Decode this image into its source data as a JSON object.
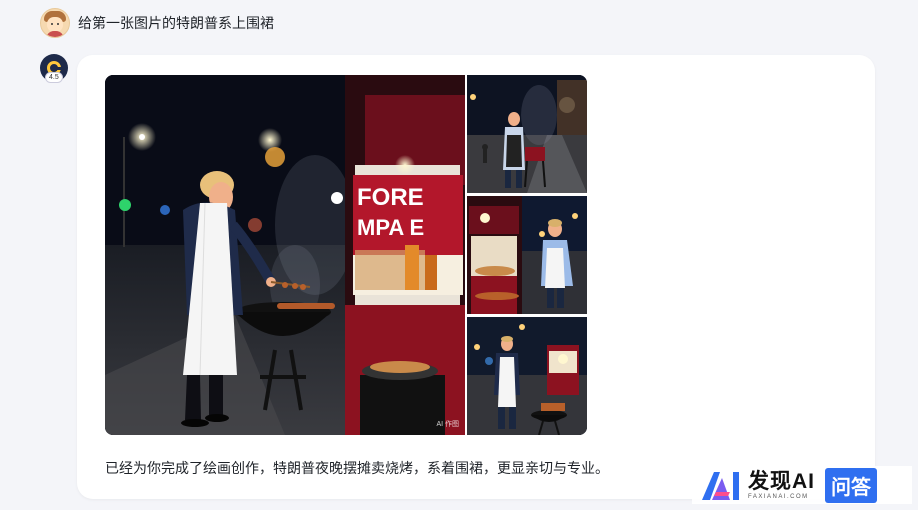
{
  "user_message": {
    "text": "给第一张图片的特朗普系上围裙"
  },
  "assistant": {
    "badge": "4.5",
    "reply": "已经为你完成了绘画创作，特朗普夜晚摆摊卖烧烤，系着围裙，更显亲切与专业。",
    "ai_mark": "AI 作图",
    "stall_sign": [
      "FORE",
      "MPA E"
    ]
  },
  "watermark": {
    "title": "发现AI",
    "sub": "FAXIANAI.COM",
    "qa": "问答"
  },
  "colors": {
    "page_bg": "#f4f5f9",
    "card_bg": "#ffffff",
    "accent": "#2f6ff0",
    "stall_red": "#b3172b"
  }
}
